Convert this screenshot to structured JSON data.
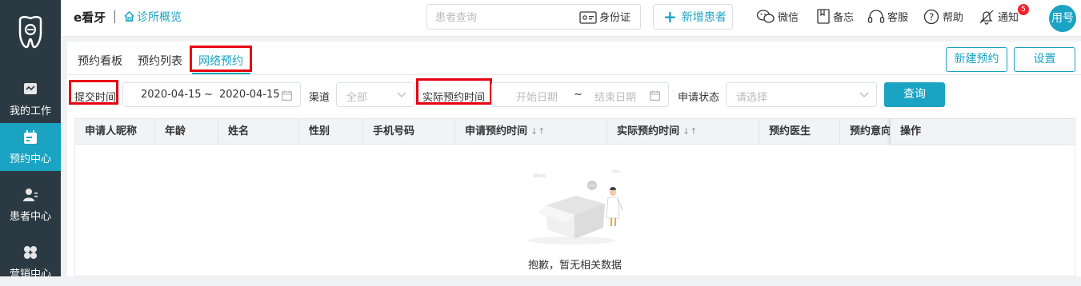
{
  "app": {
    "brand": "e看牙",
    "home_link": "诊所概览",
    "search_placeholder": "患者查询",
    "id_card_label": "身份证",
    "new_patient_label": "新增患者",
    "tools": [
      {
        "label": "微信",
        "icon": "wechat-icon"
      },
      {
        "label": "备忘",
        "icon": "memo-icon"
      },
      {
        "label": "客服",
        "icon": "headset-icon"
      },
      {
        "label": "帮助",
        "icon": "help-icon"
      },
      {
        "label": "通知",
        "icon": "bell-icon",
        "badge": "5"
      }
    ],
    "avatar_text": "用号",
    "accent": "#1aa3c2",
    "highlight": "#e60012"
  },
  "sidebar": {
    "items": [
      {
        "label": "我的工作",
        "icon": "workbench-icon",
        "active": false
      },
      {
        "label": "预约中心",
        "icon": "calendar-icon",
        "active": true
      },
      {
        "label": "患者中心",
        "icon": "patients-icon",
        "active": false
      },
      {
        "label": "营销中心",
        "icon": "marketing-icon",
        "active": false
      }
    ]
  },
  "tabs": [
    {
      "label": "预约看板",
      "active": false
    },
    {
      "label": "预约列表",
      "active": false
    },
    {
      "label": "网络预约",
      "active": true
    }
  ],
  "actions": {
    "new_appointment": "新建预约",
    "settings": "设置"
  },
  "filters": {
    "submit_time_label": "提交时间",
    "submit_start": "2020-04-15",
    "range_sep": "~",
    "submit_end": "2020-04-15",
    "channel_label": "渠道",
    "channel_value": "全部",
    "actual_time_label": "实际预约时间",
    "actual_start_placeholder": "开始日期",
    "actual_end_placeholder": "结束日期",
    "status_label": "申请状态",
    "status_placeholder": "请选择",
    "query_label": "查询"
  },
  "table": {
    "columns": [
      {
        "label": "申请人昵称",
        "sortable": false
      },
      {
        "label": "年龄",
        "sortable": false
      },
      {
        "label": "姓名",
        "sortable": false
      },
      {
        "label": "性别",
        "sortable": false
      },
      {
        "label": "手机号码",
        "sortable": false
      },
      {
        "label": "申请预约时间",
        "sortable": true
      },
      {
        "label": "实际预约时间",
        "sortable": true
      },
      {
        "label": "预约医生",
        "sortable": false
      },
      {
        "label": "预约意向",
        "sortable": false
      },
      {
        "label": "操作",
        "sortable": false
      }
    ],
    "sort_glyph": "↓↑",
    "empty_text": "抱歉，暂无相关数据"
  }
}
